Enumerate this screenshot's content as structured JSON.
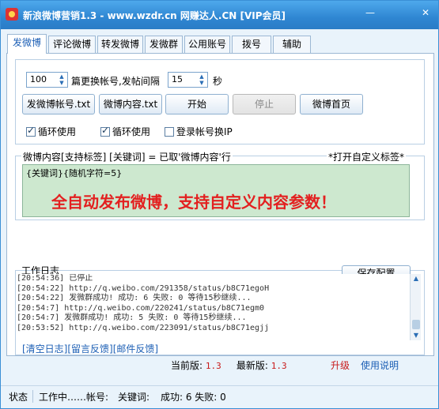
{
  "window": {
    "title": "新浪微博营销1.3 - www.wzdr.cn 网赚达人.CN [VIP会员]",
    "minimize_glyph": "—",
    "close_glyph": "✕",
    "accent_color": "#2f86d2"
  },
  "tabs": [
    {
      "label": "发微博",
      "active": true
    },
    {
      "label": "评论微博",
      "active": false
    },
    {
      "label": "转发微博",
      "active": false
    },
    {
      "label": "发微群",
      "active": false
    },
    {
      "label": "公用账号",
      "active": false
    },
    {
      "label": "拨号",
      "active": false
    },
    {
      "label": "辅助",
      "active": false
    }
  ],
  "settings": {
    "count_value": "100",
    "count_label": "篇更换帐号,发帖间隔",
    "interval_value": "15",
    "interval_unit": "秒"
  },
  "buttons": {
    "account_file": "发微博帐号.txt",
    "content_file": "微博内容.txt",
    "start": "开始",
    "stop": "停止",
    "home": "微博首页",
    "save_config": "保存配置"
  },
  "checkboxes": [
    {
      "label": "循环使用",
      "checked": true
    },
    {
      "label": "循环使用",
      "checked": true
    },
    {
      "label": "登录帐号换IP",
      "checked": false
    }
  ],
  "content": {
    "group_title": "微博内容[支持标签]  [关键词] = 已取'微博内容'行",
    "open_tags_label": "*打开自定义标签*",
    "text": "{关键词}{随机字符=5}",
    "promo": "全自动发布微博，支持自定义内容参数！"
  },
  "log": {
    "title": "工作日志",
    "lines": [
      "[20:54:36] 已停止",
      "[20:54:22] http://q.weibo.com/291358/status/b8C71egoH",
      "[20:54:22] 发微群成功! 成功: 6 失败: 0 等待15秒继续...",
      "[20:54:7] http://q.weibo.com/220241/status/b8C71egm0",
      "[20:54:7] 发微群成功! 成功: 5 失败: 0 等待15秒继续...",
      "[20:53:52] http://q.weibo.com/223091/status/b8C71egjj"
    ],
    "links": [
      "[清空日志]",
      "[留言反馈]",
      "[邮件反馈]"
    ]
  },
  "version": {
    "current_label": "当前版:",
    "current_value": "1.3",
    "latest_label": "最新版:",
    "latest_value": "1.3",
    "upgrade": "升级",
    "help": "使用说明"
  },
  "status": {
    "state_label": "状态",
    "working": "工作中……帐号:",
    "keyword": "关键词:",
    "result": "成功: 6 失败: 0"
  }
}
